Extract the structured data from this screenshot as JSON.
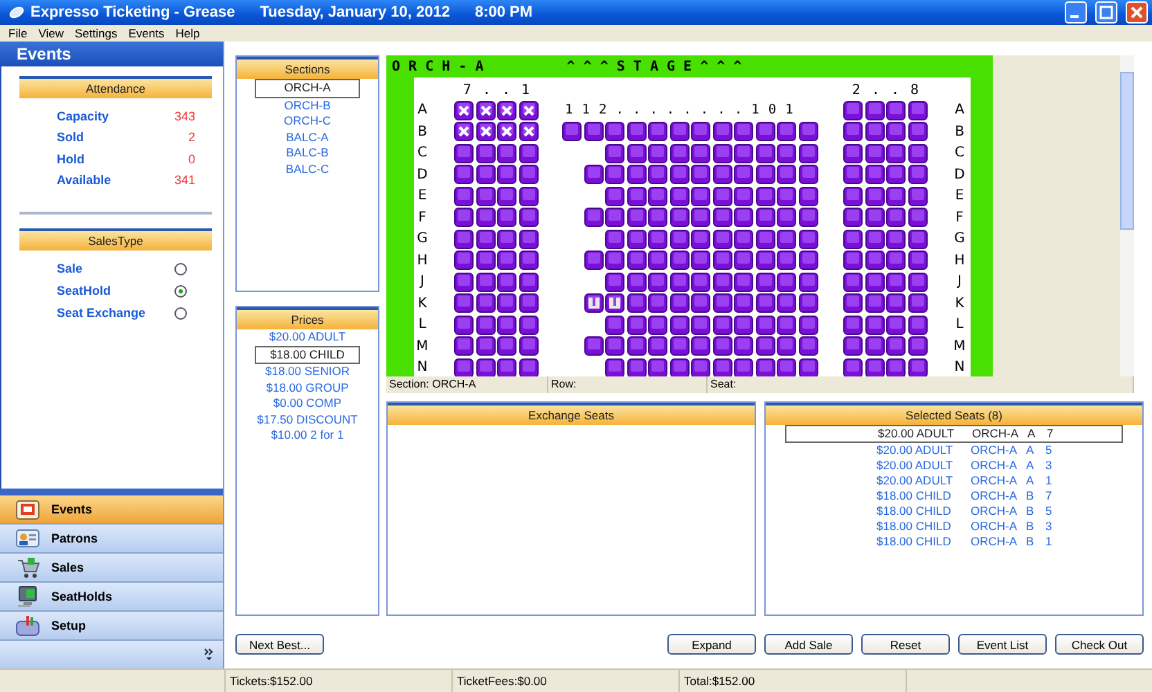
{
  "window": {
    "title": "Expresso Ticketing - Grease",
    "date": "Tuesday, January 10, 2012",
    "time": "8:00 PM"
  },
  "menu": [
    "File",
    "View",
    "Settings",
    "Events",
    "Help"
  ],
  "sidebar": {
    "title": "Events",
    "attendance": {
      "title": "Attendance",
      "items": [
        {
          "label": "Capacity",
          "value": "343"
        },
        {
          "label": "Sold",
          "value": "2"
        },
        {
          "label": "Hold",
          "value": "0"
        },
        {
          "label": "Available",
          "value": "341"
        }
      ]
    },
    "sales_type": {
      "title": "SalesType",
      "options": [
        {
          "label": "Sale",
          "selected": false
        },
        {
          "label": "SeatHold",
          "selected": true
        },
        {
          "label": "Seat Exchange",
          "selected": false
        }
      ]
    },
    "nav": [
      {
        "label": "Events",
        "kind": "calendar",
        "selected": true
      },
      {
        "label": "Patrons",
        "kind": "card",
        "selected": false
      },
      {
        "label": "Sales",
        "kind": "cart",
        "selected": false
      },
      {
        "label": "SeatHolds",
        "kind": "monitor",
        "selected": false
      },
      {
        "label": "Setup",
        "kind": "toolbox",
        "selected": false
      }
    ]
  },
  "sections": {
    "title": "Sections",
    "items": [
      {
        "label": "ORCH-A",
        "selected": true
      },
      {
        "label": "ORCH-B",
        "selected": false
      },
      {
        "label": "ORCH-C",
        "selected": false
      },
      {
        "label": "BALC-A",
        "selected": false
      },
      {
        "label": "BALC-B",
        "selected": false
      },
      {
        "label": "BALC-C",
        "selected": false
      }
    ]
  },
  "prices": {
    "title": "Prices",
    "items": [
      {
        "label": "$20.00 ADULT",
        "selected": false
      },
      {
        "label": "$18.00 CHILD",
        "selected": true
      },
      {
        "label": "$18.00 SENIOR",
        "selected": false
      },
      {
        "label": "$18.00 GROUP",
        "selected": false
      },
      {
        "label": "$0.00 COMP",
        "selected": false
      },
      {
        "label": "$17.50 DISCOUNT",
        "selected": false
      },
      {
        "label": "$10.00 2 for 1",
        "selected": false
      }
    ]
  },
  "seat_map": {
    "section": "O R C H - A",
    "stage": "^ ^ ^ S T A G E ^ ^ ^",
    "left_header": "7 . . 1",
    "right_header": "2 . . 8",
    "rows": [
      {
        "label_left": "A",
        "left": [
          {
            "kind": "sold"
          },
          {
            "kind": "sold"
          },
          {
            "kind": "sold"
          },
          {
            "kind": "sold"
          }
        ],
        "center_caption": "1 1 2 . . . . . . . . 1 0 1",
        "right": [
          {
            "kind": "open"
          },
          {
            "kind": "open"
          },
          {
            "kind": "open"
          },
          {
            "kind": "open"
          }
        ],
        "label_right": "A"
      },
      {
        "label_left": "B",
        "left": [
          {
            "kind": "sold"
          },
          {
            "kind": "sold"
          },
          {
            "kind": "sold"
          },
          {
            "kind": "sold"
          }
        ],
        "center": [
          {
            "kind": "open"
          },
          {
            "kind": "open"
          },
          {
            "kind": "open"
          },
          {
            "kind": "open"
          },
          {
            "kind": "open"
          },
          {
            "kind": "open"
          },
          {
            "kind": "open"
          },
          {
            "kind": "open"
          },
          {
            "kind": "open"
          },
          {
            "kind": "open"
          },
          {
            "kind": "open"
          },
          {
            "kind": "open"
          }
        ],
        "right": [
          {
            "kind": "open"
          },
          {
            "kind": "open"
          },
          {
            "kind": "open"
          },
          {
            "kind": "open"
          }
        ],
        "label_right": "B"
      },
      {
        "label_left": "C",
        "left": [
          {
            "kind": "open"
          },
          {
            "kind": "open"
          },
          {
            "kind": "open"
          },
          {
            "kind": "open"
          }
        ],
        "center": [
          {
            "kind": "gap"
          },
          {
            "kind": "gap"
          },
          {
            "kind": "open"
          },
          {
            "kind": "open"
          },
          {
            "kind": "open"
          },
          {
            "kind": "open"
          },
          {
            "kind": "open"
          },
          {
            "kind": "open"
          },
          {
            "kind": "open"
          },
          {
            "kind": "open"
          },
          {
            "kind": "open"
          },
          {
            "kind": "open"
          }
        ],
        "right": [
          {
            "kind": "open"
          },
          {
            "kind": "open"
          },
          {
            "kind": "open"
          },
          {
            "kind": "open"
          }
        ],
        "label_right": "C"
      },
      {
        "label_left": "D",
        "left": [
          {
            "kind": "open"
          },
          {
            "kind": "open"
          },
          {
            "kind": "open"
          },
          {
            "kind": "open"
          }
        ],
        "center": [
          {
            "kind": "gap"
          },
          {
            "kind": "open"
          },
          {
            "kind": "open"
          },
          {
            "kind": "open"
          },
          {
            "kind": "open"
          },
          {
            "kind": "open"
          },
          {
            "kind": "open"
          },
          {
            "kind": "open"
          },
          {
            "kind": "open"
          },
          {
            "kind": "open"
          },
          {
            "kind": "open"
          },
          {
            "kind": "open"
          }
        ],
        "right": [
          {
            "kind": "open"
          },
          {
            "kind": "open"
          },
          {
            "kind": "open"
          },
          {
            "kind": "open"
          }
        ],
        "label_right": "D"
      },
      {
        "label_left": "E",
        "left": [
          {
            "kind": "open"
          },
          {
            "kind": "open"
          },
          {
            "kind": "open"
          },
          {
            "kind": "open"
          }
        ],
        "center": [
          {
            "kind": "gap"
          },
          {
            "kind": "gap"
          },
          {
            "kind": "open"
          },
          {
            "kind": "open"
          },
          {
            "kind": "open"
          },
          {
            "kind": "open"
          },
          {
            "kind": "open"
          },
          {
            "kind": "open"
          },
          {
            "kind": "open"
          },
          {
            "kind": "open"
          },
          {
            "kind": "open"
          },
          {
            "kind": "open"
          }
        ],
        "right": [
          {
            "kind": "open"
          },
          {
            "kind": "open"
          },
          {
            "kind": "open"
          },
          {
            "kind": "open"
          }
        ],
        "label_right": "E"
      },
      {
        "label_left": "F",
        "left": [
          {
            "kind": "open"
          },
          {
            "kind": "open"
          },
          {
            "kind": "open"
          },
          {
            "kind": "open"
          }
        ],
        "center": [
          {
            "kind": "gap"
          },
          {
            "kind": "open"
          },
          {
            "kind": "open"
          },
          {
            "kind": "open"
          },
          {
            "kind": "open"
          },
          {
            "kind": "open"
          },
          {
            "kind": "open"
          },
          {
            "kind": "open"
          },
          {
            "kind": "open"
          },
          {
            "kind": "open"
          },
          {
            "kind": "open"
          },
          {
            "kind": "open"
          }
        ],
        "right": [
          {
            "kind": "open"
          },
          {
            "kind": "open"
          },
          {
            "kind": "open"
          },
          {
            "kind": "open"
          }
        ],
        "label_right": "F"
      },
      {
        "label_left": "G",
        "left": [
          {
            "kind": "open"
          },
          {
            "kind": "open"
          },
          {
            "kind": "open"
          },
          {
            "kind": "open"
          }
        ],
        "center": [
          {
            "kind": "gap"
          },
          {
            "kind": "gap"
          },
          {
            "kind": "open"
          },
          {
            "kind": "open"
          },
          {
            "kind": "open"
          },
          {
            "kind": "open"
          },
          {
            "kind": "open"
          },
          {
            "kind": "open"
          },
          {
            "kind": "open"
          },
          {
            "kind": "open"
          },
          {
            "kind": "open"
          },
          {
            "kind": "open"
          }
        ],
        "right": [
          {
            "kind": "open"
          },
          {
            "kind": "open"
          },
          {
            "kind": "open"
          },
          {
            "kind": "open"
          }
        ],
        "label_right": "G"
      },
      {
        "label_left": "H",
        "left": [
          {
            "kind": "open"
          },
          {
            "kind": "open"
          },
          {
            "kind": "open"
          },
          {
            "kind": "open"
          }
        ],
        "center": [
          {
            "kind": "gap"
          },
          {
            "kind": "open"
          },
          {
            "kind": "open"
          },
          {
            "kind": "open"
          },
          {
            "kind": "open"
          },
          {
            "kind": "open"
          },
          {
            "kind": "open"
          },
          {
            "kind": "open"
          },
          {
            "kind": "open"
          },
          {
            "kind": "open"
          },
          {
            "kind": "open"
          },
          {
            "kind": "open"
          }
        ],
        "right": [
          {
            "kind": "open"
          },
          {
            "kind": "open"
          },
          {
            "kind": "open"
          },
          {
            "kind": "open"
          }
        ],
        "label_right": "H"
      },
      {
        "label_left": "J",
        "left": [
          {
            "kind": "open"
          },
          {
            "kind": "open"
          },
          {
            "kind": "open"
          },
          {
            "kind": "open"
          }
        ],
        "center": [
          {
            "kind": "gap"
          },
          {
            "kind": "gap"
          },
          {
            "kind": "open"
          },
          {
            "kind": "open"
          },
          {
            "kind": "open"
          },
          {
            "kind": "open"
          },
          {
            "kind": "open"
          },
          {
            "kind": "open"
          },
          {
            "kind": "open"
          },
          {
            "kind": "open"
          },
          {
            "kind": "open"
          },
          {
            "kind": "open"
          }
        ],
        "right": [
          {
            "kind": "open"
          },
          {
            "kind": "open"
          },
          {
            "kind": "open"
          },
          {
            "kind": "open"
          }
        ],
        "label_right": "J"
      },
      {
        "label_left": "K",
        "left": [
          {
            "kind": "open"
          },
          {
            "kind": "open"
          },
          {
            "kind": "open"
          },
          {
            "kind": "open"
          }
        ],
        "center": [
          {
            "kind": "gap"
          },
          {
            "kind": "held"
          },
          {
            "kind": "held"
          },
          {
            "kind": "open"
          },
          {
            "kind": "open"
          },
          {
            "kind": "open"
          },
          {
            "kind": "open"
          },
          {
            "kind": "open"
          },
          {
            "kind": "open"
          },
          {
            "kind": "open"
          },
          {
            "kind": "open"
          },
          {
            "kind": "open"
          }
        ],
        "right": [
          {
            "kind": "open"
          },
          {
            "kind": "open"
          },
          {
            "kind": "open"
          },
          {
            "kind": "open"
          }
        ],
        "label_right": "K"
      },
      {
        "label_left": "L",
        "left": [
          {
            "kind": "open"
          },
          {
            "kind": "open"
          },
          {
            "kind": "open"
          },
          {
            "kind": "open"
          }
        ],
        "center": [
          {
            "kind": "gap"
          },
          {
            "kind": "gap"
          },
          {
            "kind": "open"
          },
          {
            "kind": "open"
          },
          {
            "kind": "open"
          },
          {
            "kind": "open"
          },
          {
            "kind": "open"
          },
          {
            "kind": "open"
          },
          {
            "kind": "open"
          },
          {
            "kind": "open"
          },
          {
            "kind": "open"
          },
          {
            "kind": "open"
          }
        ],
        "right": [
          {
            "kind": "open"
          },
          {
            "kind": "open"
          },
          {
            "kind": "open"
          },
          {
            "kind": "open"
          }
        ],
        "label_right": "L"
      },
      {
        "label_left": "M",
        "left": [
          {
            "kind": "open"
          },
          {
            "kind": "open"
          },
          {
            "kind": "open"
          },
          {
            "kind": "open"
          }
        ],
        "center": [
          {
            "kind": "gap"
          },
          {
            "kind": "open"
          },
          {
            "kind": "open"
          },
          {
            "kind": "open"
          },
          {
            "kind": "open"
          },
          {
            "kind": "open"
          },
          {
            "kind": "open"
          },
          {
            "kind": "open"
          },
          {
            "kind": "open"
          },
          {
            "kind": "open"
          },
          {
            "kind": "open"
          },
          {
            "kind": "open"
          }
        ],
        "right": [
          {
            "kind": "open"
          },
          {
            "kind": "open"
          },
          {
            "kind": "open"
          },
          {
            "kind": "open"
          }
        ],
        "label_right": "M"
      },
      {
        "label_left": "N",
        "left": [
          {
            "kind": "open"
          },
          {
            "kind": "open"
          },
          {
            "kind": "open"
          },
          {
            "kind": "open"
          }
        ],
        "center": [
          {
            "kind": "gap"
          },
          {
            "kind": "gap"
          },
          {
            "kind": "open"
          },
          {
            "kind": "open"
          },
          {
            "kind": "open"
          },
          {
            "kind": "open"
          },
          {
            "kind": "open"
          },
          {
            "kind": "open"
          },
          {
            "kind": "open"
          },
          {
            "kind": "open"
          },
          {
            "kind": "open"
          },
          {
            "kind": "open"
          }
        ],
        "right": [
          {
            "kind": "open"
          },
          {
            "kind": "open"
          },
          {
            "kind": "open"
          },
          {
            "kind": "open"
          }
        ],
        "label_right": "N"
      }
    ]
  },
  "info_bar": {
    "section": "Section: ORCH-A",
    "row": "Row:",
    "seat": "Seat:"
  },
  "exchange_seats": {
    "title": "Exchange Seats"
  },
  "selected_seats": {
    "title": "Selected Seats  (8)",
    "items": [
      {
        "price": "$20.00 ADULT",
        "section": "ORCH-A",
        "row": "A",
        "seat": "7",
        "selected": true
      },
      {
        "price": "$20.00 ADULT",
        "section": "ORCH-A",
        "row": "A",
        "seat": "5",
        "selected": false
      },
      {
        "price": "$20.00 ADULT",
        "section": "ORCH-A",
        "row": "A",
        "seat": "3",
        "selected": false
      },
      {
        "price": "$20.00 ADULT",
        "section": "ORCH-A",
        "row": "A",
        "seat": "1",
        "selected": false
      },
      {
        "price": "$18.00 CHILD",
        "section": "ORCH-A",
        "row": "B",
        "seat": "7",
        "selected": false
      },
      {
        "price": "$18.00 CHILD",
        "section": "ORCH-A",
        "row": "B",
        "seat": "5",
        "selected": false
      },
      {
        "price": "$18.00 CHILD",
        "section": "ORCH-A",
        "row": "B",
        "seat": "3",
        "selected": false
      },
      {
        "price": "$18.00 CHILD",
        "section": "ORCH-A",
        "row": "B",
        "seat": "1",
        "selected": false
      }
    ]
  },
  "buttons_left": [
    "Next Best..."
  ],
  "buttons_right": [
    "Expand",
    "Add Sale",
    "Reset",
    "Event List",
    "Check Out"
  ],
  "status_bar": [
    "Tickets:$152.00",
    "TicketFees:$0.00",
    "Total:$152.00"
  ]
}
